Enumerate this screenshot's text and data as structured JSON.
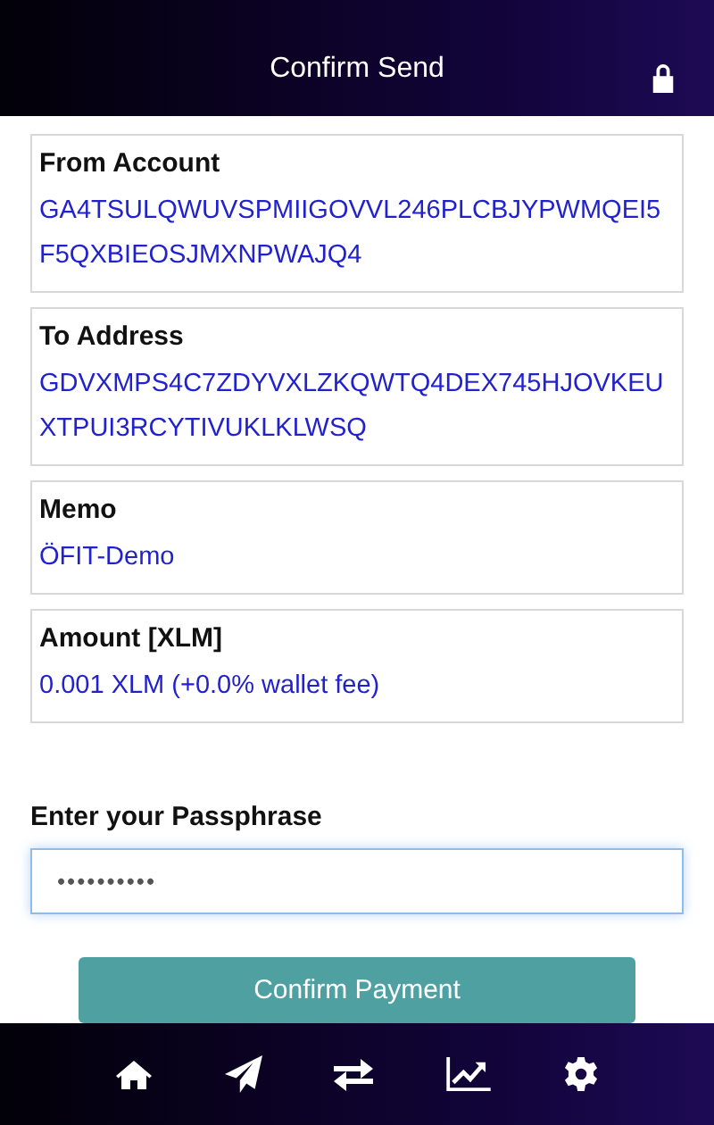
{
  "header": {
    "title": "Confirm Send"
  },
  "details": [
    {
      "label": "From Account",
      "value": "GA4TSULQWUVSPMIIGOVVL246PLCBJYPWMQEI5F5QXBIEOSJMXNPWAJQ4"
    },
    {
      "label": "To Address",
      "value": "GDVXMPS4C7ZDYVXLZKQWTQ4DEX745HJOVKEUXTPUI3RCYTIVUKLKLWSQ"
    },
    {
      "label": "Memo",
      "value": "ÖFIT-Demo"
    },
    {
      "label": "Amount [XLM]",
      "value": "0.001 XLM (+0.0% wallet fee)"
    }
  ],
  "passphrase": {
    "label": "Enter your Passphrase",
    "value": "••••••••••"
  },
  "confirm_button": "Confirm Payment"
}
